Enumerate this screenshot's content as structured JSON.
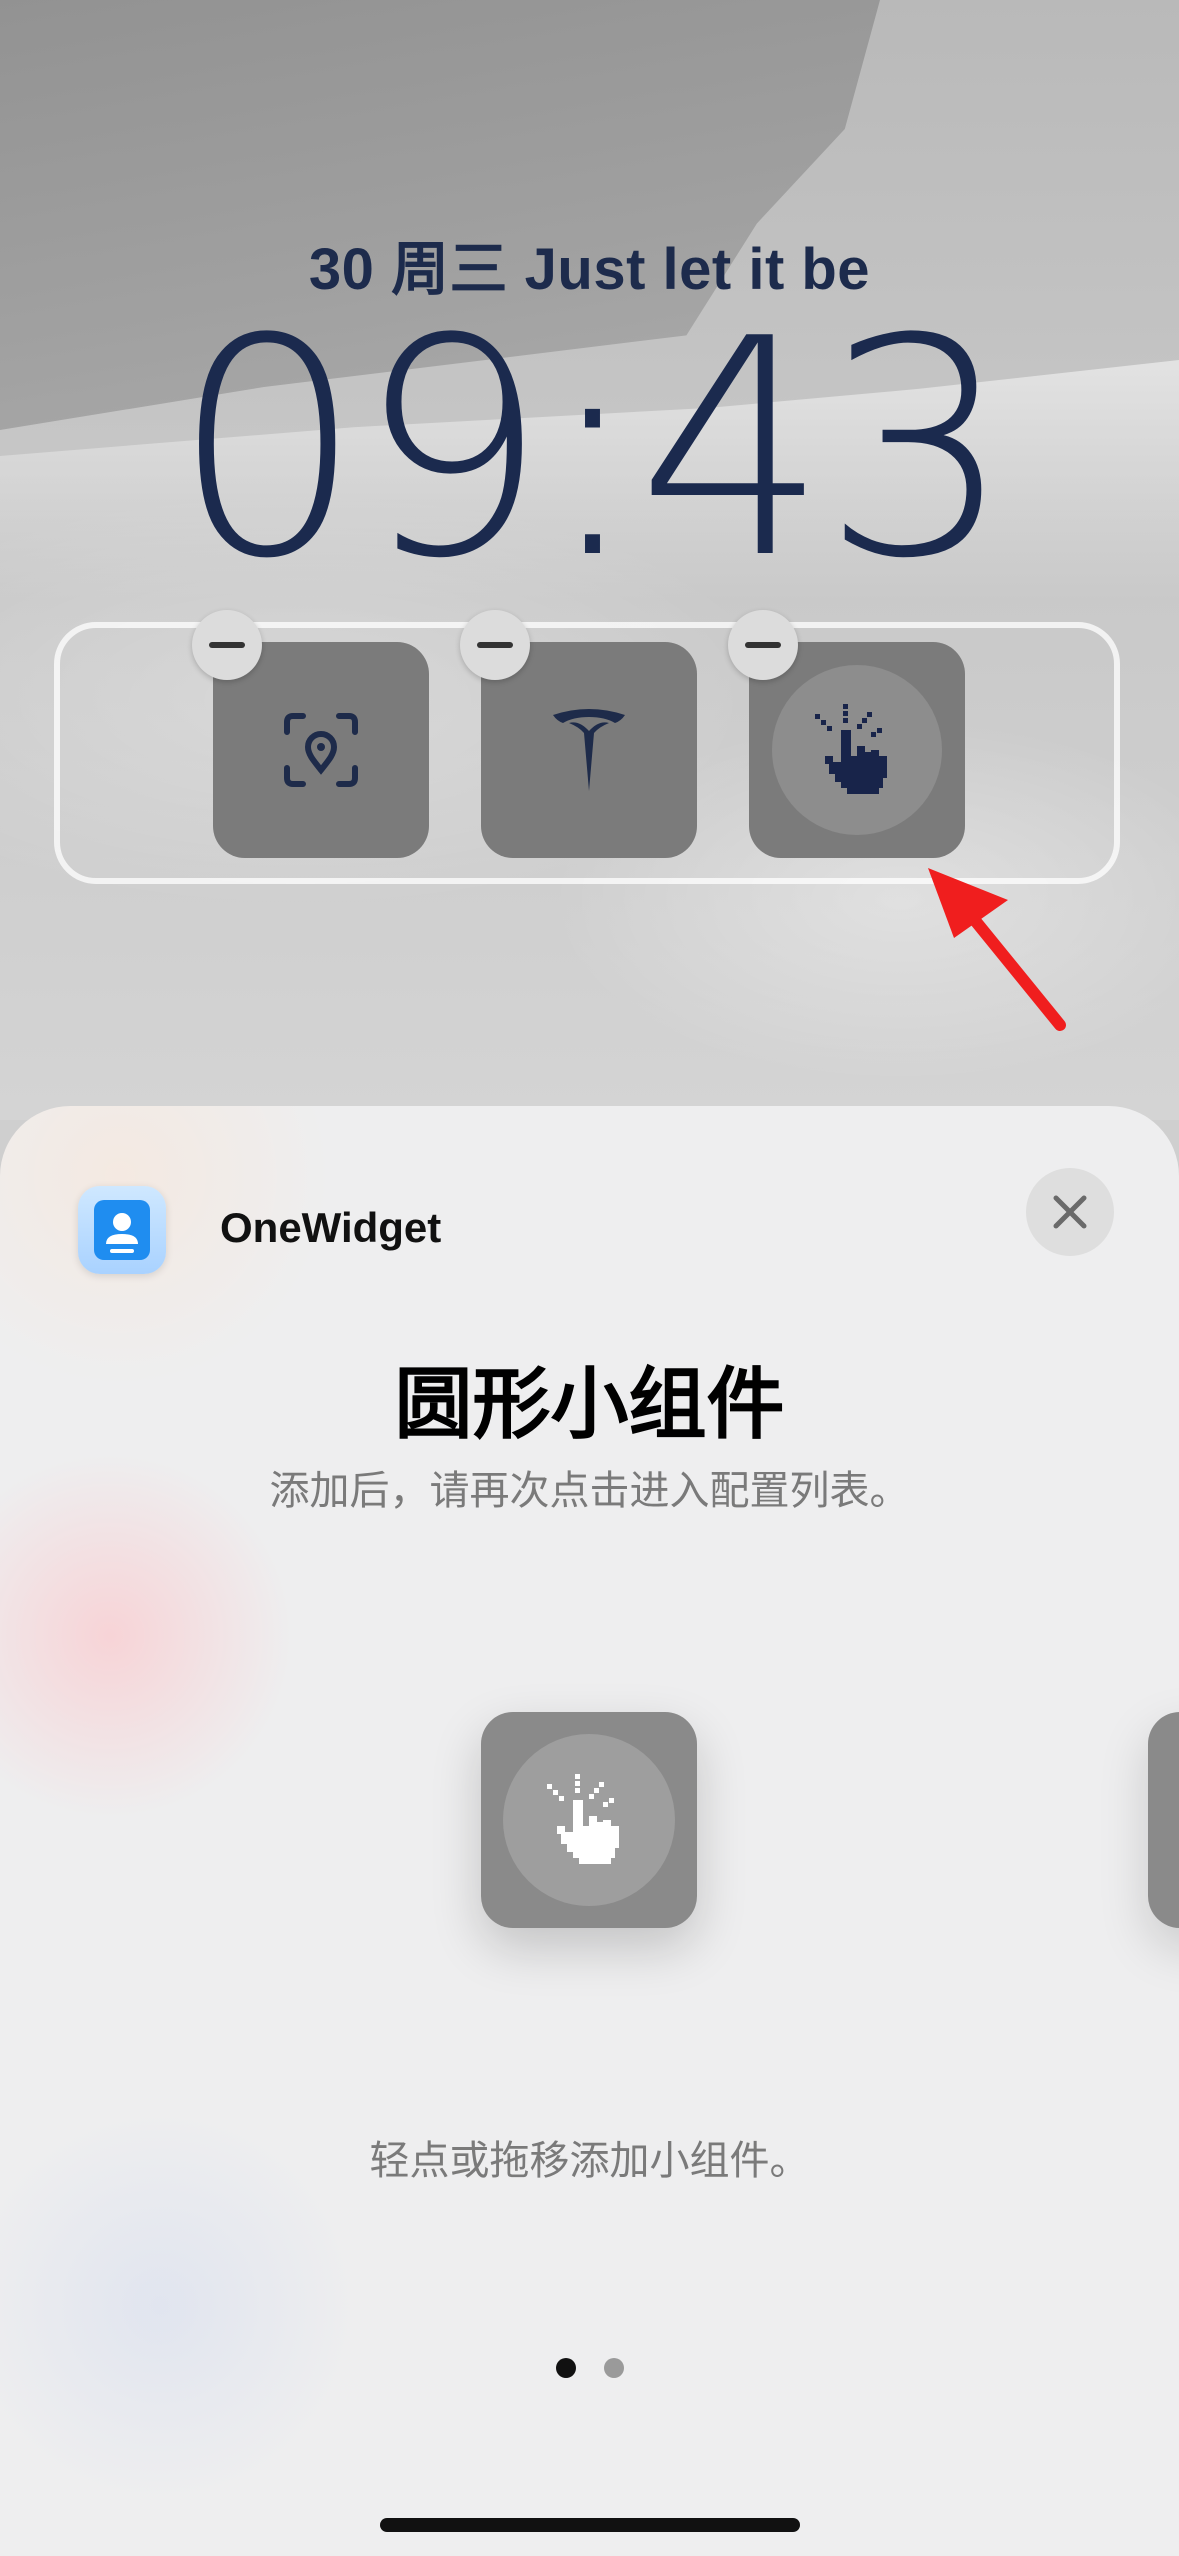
{
  "lock_screen": {
    "date_line": "30 周三  Just let it be",
    "time": "09:43",
    "widgets": [
      {
        "icon": "face-id-location-icon"
      },
      {
        "icon": "tesla-logo-icon"
      },
      {
        "icon": "hand-click-icon"
      }
    ]
  },
  "sheet": {
    "app_name": "OneWidget",
    "title": "圆形小组件",
    "subtitle": "添加后，请再次点击进入配置列表。",
    "hint": "轻点或拖移添加小组件。",
    "page_count": 2,
    "current_page": 1
  },
  "colors": {
    "time_text": "#1b2a4e",
    "arrow": "#f01e1e",
    "widget_tile": "#7b7b7b"
  }
}
